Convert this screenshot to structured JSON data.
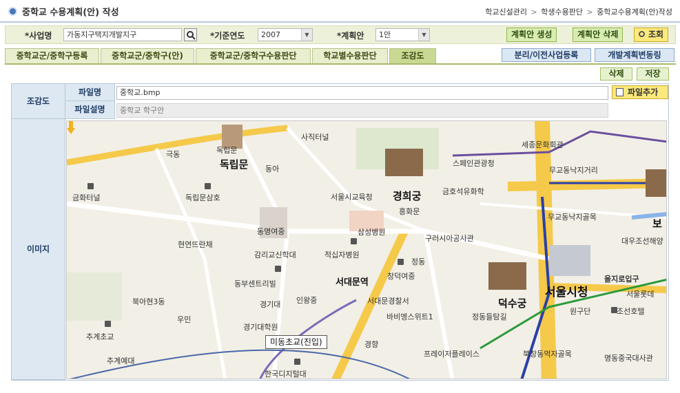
{
  "header": {
    "title": "중학교 수용계획(안) 작성",
    "breadcrumb": [
      "학교신설관리",
      "학생수용판단",
      "중학교수용계획(안)작성"
    ]
  },
  "search": {
    "project_label": "*사업명",
    "project_value": "가동지구택지개발지구",
    "year_label": "*기준연도",
    "year_value": "2007",
    "plan_label": "*계획안",
    "plan_value": "1안",
    "btn_create": "계획안 생성",
    "btn_delete": "계획안 삭제",
    "btn_search": "조회"
  },
  "tabs": [
    {
      "label": "중학교군/중학구등록"
    },
    {
      "label": "중학교군/중학구(안)"
    },
    {
      "label": "중학교군/중학구수용판단"
    },
    {
      "label": "학교별수용판단"
    },
    {
      "label": "조감도"
    }
  ],
  "right_buttons": {
    "separate": "분리/이전사업등록",
    "dev_change": "개발계획변동링"
  },
  "actions": {
    "delete": "삭제",
    "save": "저장"
  },
  "detail": {
    "section_label": "조감도",
    "file_name_label": "파일명",
    "file_name_value": "중학교.bmp",
    "file_desc_label": "파일설명",
    "file_desc_value": "중학교 학구안",
    "add_file": "파일추가",
    "image_label": "이미지"
  },
  "map": {
    "labels": [
      "독립문",
      "경희궁",
      "서대문역",
      "서울시청",
      "덕수궁",
      "사직터널",
      "금화터널",
      "독립문삼호",
      "동명여중",
      "현연뜨란채",
      "감리교신학대",
      "동부센트리빌",
      "경기대",
      "인왕중",
      "북아현3동",
      "우민",
      "경기대학원",
      "추계초교",
      "추계예대",
      "한국디지털대",
      "서울시교육청",
      "흥화문",
      "삼성병원",
      "적십자병원",
      "구러시아공사관",
      "정동",
      "창덕여중",
      "서대문경찰서",
      "바비엥스위트1",
      "정동들탐길",
      "경향",
      "프레이저플레이스",
      "북창동먹자골목",
      "원구단",
      "조선호텔",
      "을지로입구",
      "서울롯데",
      "명동중국대사관",
      "세종문화회관",
      "스페인관광청",
      "무교동낙지거리",
      "무교동낙지골목",
      "금호석유화학",
      "대우조선해양",
      "극동",
      "독립문",
      "동아",
      "보"
    ],
    "callout": "미동초교(진입)"
  }
}
